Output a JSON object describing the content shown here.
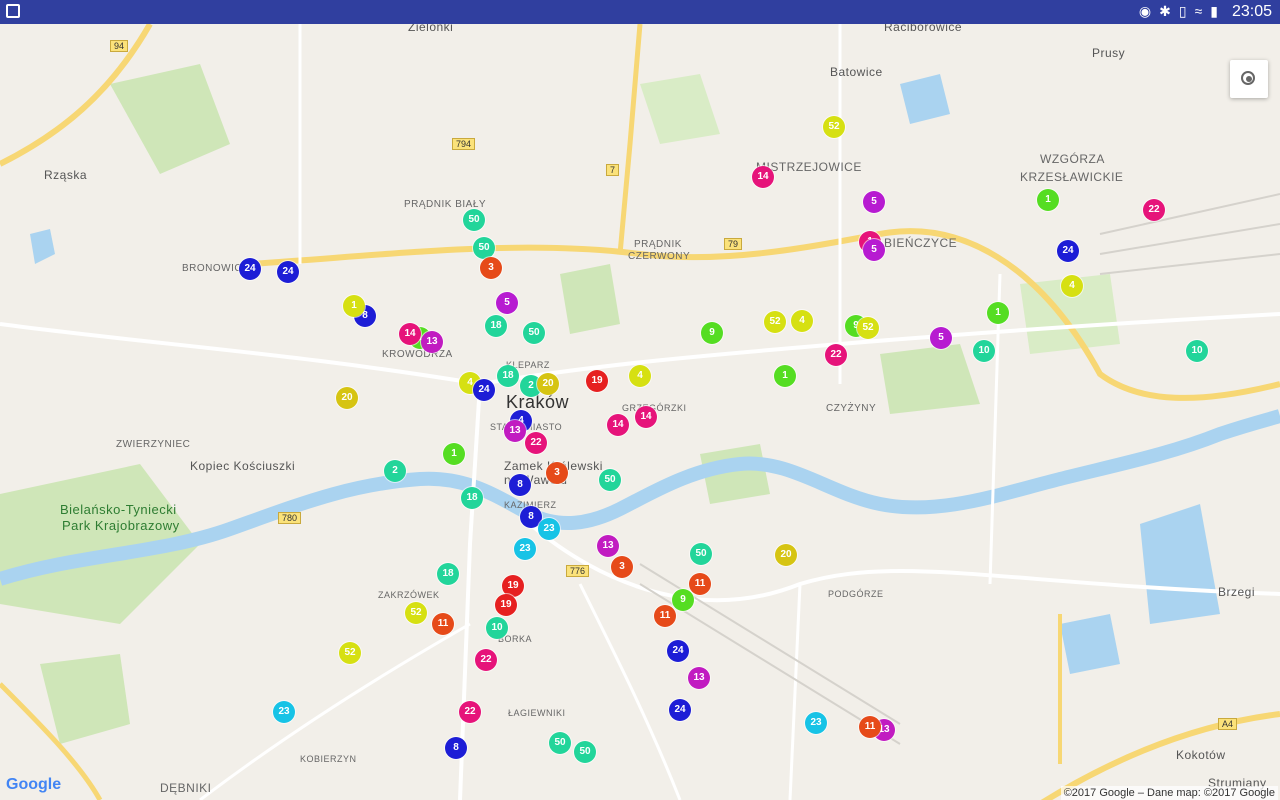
{
  "status_bar": {
    "time": "23:05",
    "icons": [
      "location-icon",
      "bluetooth-icon",
      "vibrate-icon",
      "wifi-icon",
      "battery-icon"
    ]
  },
  "map": {
    "places": [
      {
        "id": "zielonki",
        "text": "Zielonki"
      },
      {
        "id": "raciborowice",
        "text": "Raciborowice"
      },
      {
        "id": "prusy",
        "text": "Prusy"
      },
      {
        "id": "batowice",
        "text": "Batowice"
      },
      {
        "id": "rzaska",
        "text": "Rząska"
      },
      {
        "id": "mistrzejowice",
        "text": "MISTRZEJOWICE"
      },
      {
        "id": "wzgorza1",
        "text": "WZGÓRZA"
      },
      {
        "id": "wzgorza2",
        "text": "KRZESŁAWICKIE"
      },
      {
        "id": "pradnik_bialy",
        "text": "PRĄDNIK BIAŁY"
      },
      {
        "id": "pradnik_czerwony1",
        "text": "PRĄDNIK"
      },
      {
        "id": "pradnik_czerwony2",
        "text": "CZERWONY"
      },
      {
        "id": "bienczyce",
        "text": "BIEŃCZYCE"
      },
      {
        "id": "bronowice",
        "text": "BRONOWICE"
      },
      {
        "id": "krowodrza",
        "text": "KROWODRZA"
      },
      {
        "id": "krakow",
        "text": "Kraków"
      },
      {
        "id": "kleparz",
        "text": "KLEPARZ"
      },
      {
        "id": "grzegorzki",
        "text": "GRZEGÓRZKI"
      },
      {
        "id": "czyzyny",
        "text": "CZYŻYNY"
      },
      {
        "id": "zwierzyniec",
        "text": "ZWIERZYNIEC"
      },
      {
        "id": "kopiec",
        "text": "Kopiec Kościuszki"
      },
      {
        "id": "stare_miasto",
        "text": "STARE MIASTO"
      },
      {
        "id": "zamek1",
        "text": "Zamek Królewski"
      },
      {
        "id": "zamek2",
        "text": "na Wawelu"
      },
      {
        "id": "kazimierz",
        "text": "KAZIMIERZ"
      },
      {
        "id": "park1",
        "text": "Bielańsko-Tyniecki"
      },
      {
        "id": "park2",
        "text": "Park Krajobrazowy"
      },
      {
        "id": "zakrzowek",
        "text": "ZAKRZÓWEK"
      },
      {
        "id": "podgorze",
        "text": "PODGÓRZE"
      },
      {
        "id": "brzegi",
        "text": "Brzegi"
      },
      {
        "id": "debniki",
        "text": "DĘBNIKI"
      },
      {
        "id": "lagiewniki",
        "text": "ŁAGIEWNIKI"
      },
      {
        "id": "borek",
        "text": "BORKA"
      },
      {
        "id": "kobierzyn",
        "text": "KOBIERZYN"
      },
      {
        "id": "kokotow",
        "text": "Kokotów"
      },
      {
        "id": "strumiany",
        "text": "Strumiany"
      }
    ],
    "road_numbers": [
      "94",
      "794",
      "7",
      "79",
      "780",
      "776",
      "A4"
    ],
    "markers": [
      {
        "num": "24",
        "color": "#1d1dd6"
      },
      {
        "num": "24",
        "color": "#1d1dd6"
      },
      {
        "num": "8",
        "color": "#1d1dd6"
      },
      {
        "num": "1",
        "color": "#d6e012"
      },
      {
        "num": "50",
        "color": "#22d59a"
      },
      {
        "num": "50",
        "color": "#22d59a"
      },
      {
        "num": "3",
        "color": "#e64a19"
      },
      {
        "num": "5",
        "color": "#b71bd1"
      },
      {
        "num": "18",
        "color": "#22d59a"
      },
      {
        "num": "50",
        "color": "#22d59a"
      },
      {
        "num": "1",
        "color": "#55dd22"
      },
      {
        "num": "13",
        "color": "#c11bc1"
      },
      {
        "num": "14",
        "color": "#e6137a"
      },
      {
        "num": "20",
        "color": "#d6c412"
      },
      {
        "num": "4",
        "color": "#d6e012"
      },
      {
        "num": "24",
        "color": "#1d1dd6"
      },
      {
        "num": "18",
        "color": "#22d59a"
      },
      {
        "num": "2",
        "color": "#22d59a"
      },
      {
        "num": "20",
        "color": "#d6c412"
      },
      {
        "num": "19",
        "color": "#e62020"
      },
      {
        "num": "4",
        "color": "#d6e012"
      },
      {
        "num": "4",
        "color": "#1d1dd6"
      },
      {
        "num": "13",
        "color": "#c11bc1"
      },
      {
        "num": "22",
        "color": "#e6137a"
      },
      {
        "num": "14",
        "color": "#e6137a"
      },
      {
        "num": "14",
        "color": "#e6137a"
      },
      {
        "num": "2",
        "color": "#22d59a"
      },
      {
        "num": "1",
        "color": "#55dd22"
      },
      {
        "num": "3",
        "color": "#e64a19"
      },
      {
        "num": "8",
        "color": "#1d1dd6"
      },
      {
        "num": "18",
        "color": "#22d59a"
      },
      {
        "num": "50",
        "color": "#22d59a"
      },
      {
        "num": "8",
        "color": "#1d1dd6"
      },
      {
        "num": "23",
        "color": "#17c3e6"
      },
      {
        "num": "23",
        "color": "#17c3e6"
      },
      {
        "num": "13",
        "color": "#c11bc1"
      },
      {
        "num": "3",
        "color": "#e64a19"
      },
      {
        "num": "18",
        "color": "#22d59a"
      },
      {
        "num": "19",
        "color": "#e62020"
      },
      {
        "num": "19",
        "color": "#e62020"
      },
      {
        "num": "52",
        "color": "#d6e012"
      },
      {
        "num": "11",
        "color": "#e64a19"
      },
      {
        "num": "10",
        "color": "#22d59a"
      },
      {
        "num": "22",
        "color": "#e6137a"
      },
      {
        "num": "52",
        "color": "#d6e012"
      },
      {
        "num": "23",
        "color": "#17c3e6"
      },
      {
        "num": "22",
        "color": "#e6137a"
      },
      {
        "num": "8",
        "color": "#1d1dd6"
      },
      {
        "num": "50",
        "color": "#22d59a"
      },
      {
        "num": "50",
        "color": "#22d59a"
      },
      {
        "num": "50",
        "color": "#22d59a"
      },
      {
        "num": "20",
        "color": "#d6c412"
      },
      {
        "num": "11",
        "color": "#e64a19"
      },
      {
        "num": "9",
        "color": "#55dd22"
      },
      {
        "num": "11",
        "color": "#e64a19"
      },
      {
        "num": "24",
        "color": "#1d1dd6"
      },
      {
        "num": "13",
        "color": "#c11bc1"
      },
      {
        "num": "24",
        "color": "#1d1dd6"
      },
      {
        "num": "23",
        "color": "#17c3e6"
      },
      {
        "num": "13",
        "color": "#c11bc1"
      },
      {
        "num": "11",
        "color": "#e64a19"
      },
      {
        "num": "9",
        "color": "#55dd22"
      },
      {
        "num": "52",
        "color": "#d6e012"
      },
      {
        "num": "4",
        "color": "#d6e012"
      },
      {
        "num": "1",
        "color": "#55dd22"
      },
      {
        "num": "22",
        "color": "#e6137a"
      },
      {
        "num": "9",
        "color": "#55dd22"
      },
      {
        "num": "52",
        "color": "#d6e012"
      },
      {
        "num": "5",
        "color": "#b71bd1"
      },
      {
        "num": "10",
        "color": "#22d59a"
      },
      {
        "num": "1",
        "color": "#55dd22"
      },
      {
        "num": "10",
        "color": "#22d59a"
      },
      {
        "num": "14",
        "color": "#e6137a"
      },
      {
        "num": "52",
        "color": "#d6e012"
      },
      {
        "num": "5",
        "color": "#b71bd1"
      },
      {
        "num": "1",
        "color": "#e6137a"
      },
      {
        "num": "5",
        "color": "#b71bd1"
      },
      {
        "num": "1",
        "color": "#55dd22"
      },
      {
        "num": "24",
        "color": "#1d1dd6"
      },
      {
        "num": "4",
        "color": "#d6e012"
      },
      {
        "num": "22",
        "color": "#e6137a"
      }
    ]
  },
  "google_logo": "Google",
  "copyright": "©2017 Google – Dane map: ©2017 Google"
}
